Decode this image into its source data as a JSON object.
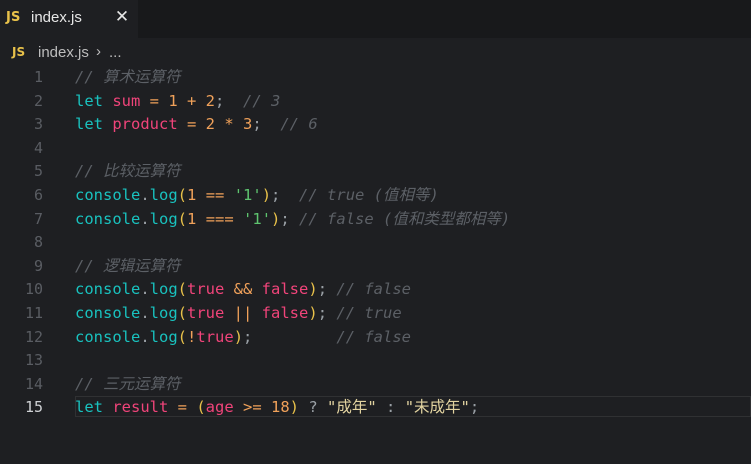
{
  "tab": {
    "label": "index.js",
    "badge": "JS",
    "close": "✕"
  },
  "breadcrumb": {
    "badge": "JS",
    "file": "index.js",
    "chevron": "›",
    "more": "..."
  },
  "editor": {
    "current_line": 15,
    "lines": [
      {
        "n": "1",
        "tokens": [
          {
            "t": "// 算术运算符",
            "c": "comment"
          }
        ]
      },
      {
        "n": "2",
        "tokens": [
          {
            "t": "let ",
            "c": "kw"
          },
          {
            "t": "sum",
            "c": "var"
          },
          {
            "t": " = ",
            "c": "op"
          },
          {
            "t": "1",
            "c": "num"
          },
          {
            "t": " + ",
            "c": "op"
          },
          {
            "t": "2",
            "c": "num"
          },
          {
            "t": ";  ",
            "c": "punc"
          },
          {
            "t": "// 3",
            "c": "comment"
          }
        ]
      },
      {
        "n": "3",
        "tokens": [
          {
            "t": "let ",
            "c": "kw"
          },
          {
            "t": "product",
            "c": "var"
          },
          {
            "t": " = ",
            "c": "op"
          },
          {
            "t": "2",
            "c": "num"
          },
          {
            "t": " * ",
            "c": "op"
          },
          {
            "t": "3",
            "c": "num"
          },
          {
            "t": ";  ",
            "c": "punc"
          },
          {
            "t": "// 6",
            "c": "comment"
          }
        ]
      },
      {
        "n": "4",
        "tokens": []
      },
      {
        "n": "5",
        "tokens": [
          {
            "t": "// 比较运算符",
            "c": "comment"
          }
        ]
      },
      {
        "n": "6",
        "tokens": [
          {
            "t": "console",
            "c": "obj"
          },
          {
            "t": ".",
            "c": "punc"
          },
          {
            "t": "log",
            "c": "fn"
          },
          {
            "t": "(",
            "c": "paren"
          },
          {
            "t": "1",
            "c": "num"
          },
          {
            "t": " == ",
            "c": "op"
          },
          {
            "t": "'1'",
            "c": "str1"
          },
          {
            "t": ")",
            "c": "paren"
          },
          {
            "t": ";  ",
            "c": "punc"
          },
          {
            "t": "// true (值相等)",
            "c": "comment"
          }
        ]
      },
      {
        "n": "7",
        "tokens": [
          {
            "t": "console",
            "c": "obj"
          },
          {
            "t": ".",
            "c": "punc"
          },
          {
            "t": "log",
            "c": "fn"
          },
          {
            "t": "(",
            "c": "paren"
          },
          {
            "t": "1",
            "c": "num"
          },
          {
            "t": " === ",
            "c": "op"
          },
          {
            "t": "'1'",
            "c": "str1"
          },
          {
            "t": ")",
            "c": "paren"
          },
          {
            "t": "; ",
            "c": "punc"
          },
          {
            "t": "// false (值和类型都相等)",
            "c": "comment"
          }
        ]
      },
      {
        "n": "8",
        "tokens": []
      },
      {
        "n": "9",
        "tokens": [
          {
            "t": "// 逻辑运算符",
            "c": "comment"
          }
        ]
      },
      {
        "n": "10",
        "tokens": [
          {
            "t": "console",
            "c": "obj"
          },
          {
            "t": ".",
            "c": "punc"
          },
          {
            "t": "log",
            "c": "fn"
          },
          {
            "t": "(",
            "c": "paren"
          },
          {
            "t": "true",
            "c": "bool"
          },
          {
            "t": " && ",
            "c": "op"
          },
          {
            "t": "false",
            "c": "bool"
          },
          {
            "t": ")",
            "c": "paren"
          },
          {
            "t": "; ",
            "c": "punc"
          },
          {
            "t": "// false",
            "c": "comment"
          }
        ]
      },
      {
        "n": "11",
        "tokens": [
          {
            "t": "console",
            "c": "obj"
          },
          {
            "t": ".",
            "c": "punc"
          },
          {
            "t": "log",
            "c": "fn"
          },
          {
            "t": "(",
            "c": "paren"
          },
          {
            "t": "true",
            "c": "bool"
          },
          {
            "t": " || ",
            "c": "op"
          },
          {
            "t": "false",
            "c": "bool"
          },
          {
            "t": ")",
            "c": "paren"
          },
          {
            "t": "; ",
            "c": "punc"
          },
          {
            "t": "// true",
            "c": "comment"
          }
        ]
      },
      {
        "n": "12",
        "tokens": [
          {
            "t": "console",
            "c": "obj"
          },
          {
            "t": ".",
            "c": "punc"
          },
          {
            "t": "log",
            "c": "fn"
          },
          {
            "t": "(",
            "c": "paren"
          },
          {
            "t": "!",
            "c": "op"
          },
          {
            "t": "true",
            "c": "bool"
          },
          {
            "t": ")",
            "c": "paren"
          },
          {
            "t": ";         ",
            "c": "punc"
          },
          {
            "t": "// false",
            "c": "comment"
          }
        ]
      },
      {
        "n": "13",
        "tokens": []
      },
      {
        "n": "14",
        "tokens": [
          {
            "t": "// 三元运算符",
            "c": "comment"
          }
        ]
      },
      {
        "n": "15",
        "tokens": [
          {
            "t": "let ",
            "c": "kw"
          },
          {
            "t": "result",
            "c": "var"
          },
          {
            "t": " = ",
            "c": "op"
          },
          {
            "t": "(",
            "c": "paren"
          },
          {
            "t": "age",
            "c": "var"
          },
          {
            "t": " >= ",
            "c": "op"
          },
          {
            "t": "18",
            "c": "num"
          },
          {
            "t": ")",
            "c": "paren"
          },
          {
            "t": " ? ",
            "c": "punc"
          },
          {
            "t": "\"成年\"",
            "c": "str2"
          },
          {
            "t": " : ",
            "c": "punc"
          },
          {
            "t": "\"未成年\"",
            "c": "str2"
          },
          {
            "t": ";",
            "c": "punc"
          }
        ]
      }
    ]
  }
}
